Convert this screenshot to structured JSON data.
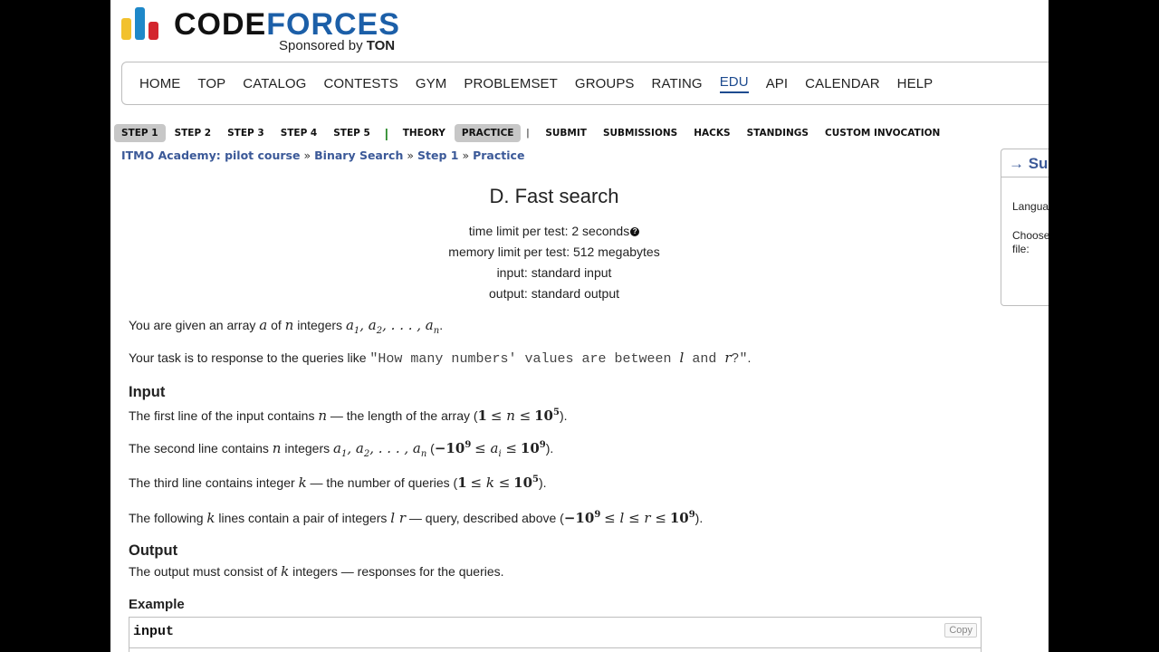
{
  "logo": {
    "word_black": "CODE",
    "word_blue": "FORCES",
    "sponsor_text": "Sponsored by",
    "sponsor_brand": "TON",
    "bar_colors": [
      "#f2c12e",
      "#1e88c9",
      "#d3262e"
    ]
  },
  "main_menu": [
    "HOME",
    "TOP",
    "CATALOG",
    "CONTESTS",
    "GYM",
    "PROBLEMSET",
    "GROUPS",
    "RATING",
    "EDU",
    "API",
    "CALENDAR",
    "HELP"
  ],
  "main_menu_active": "EDU",
  "second_menu": {
    "steps": [
      "STEP 1",
      "STEP 2",
      "STEP 3",
      "STEP 4",
      "STEP 5"
    ],
    "theory": "THEORY",
    "practice": "PRACTICE",
    "pipe": "|",
    "rest": [
      "SUBMIT",
      "SUBMISSIONS",
      "HACKS",
      "STANDINGS",
      "CUSTOM INVOCATION"
    ]
  },
  "breadcrumb": {
    "items": [
      "ITMO Academy: pilot course",
      "Binary Search",
      "Step 1",
      "Practice"
    ],
    "separator": "»"
  },
  "sidebar": {
    "title": "→ Su",
    "language_label": "Langua",
    "choose_label_1": "Choose",
    "choose_label_2": "file:"
  },
  "problem": {
    "title": "D. Fast search",
    "time_limit": "time limit per test: 2 seconds",
    "memory_limit": "memory limit per test: 512 megabytes",
    "input": "input: standard input",
    "output": "output: standard output",
    "statement_1": "You are given an array",
    "statement_2": "Your task is to response to the queries like",
    "query_mono": "\"How many numbers' values are between",
    "input_heading": "Input",
    "output_heading": "Output",
    "output_text": "integers — responses for the queries.",
    "example_heading": "Example",
    "example_input_label": "input",
    "copy_label": "Copy"
  }
}
